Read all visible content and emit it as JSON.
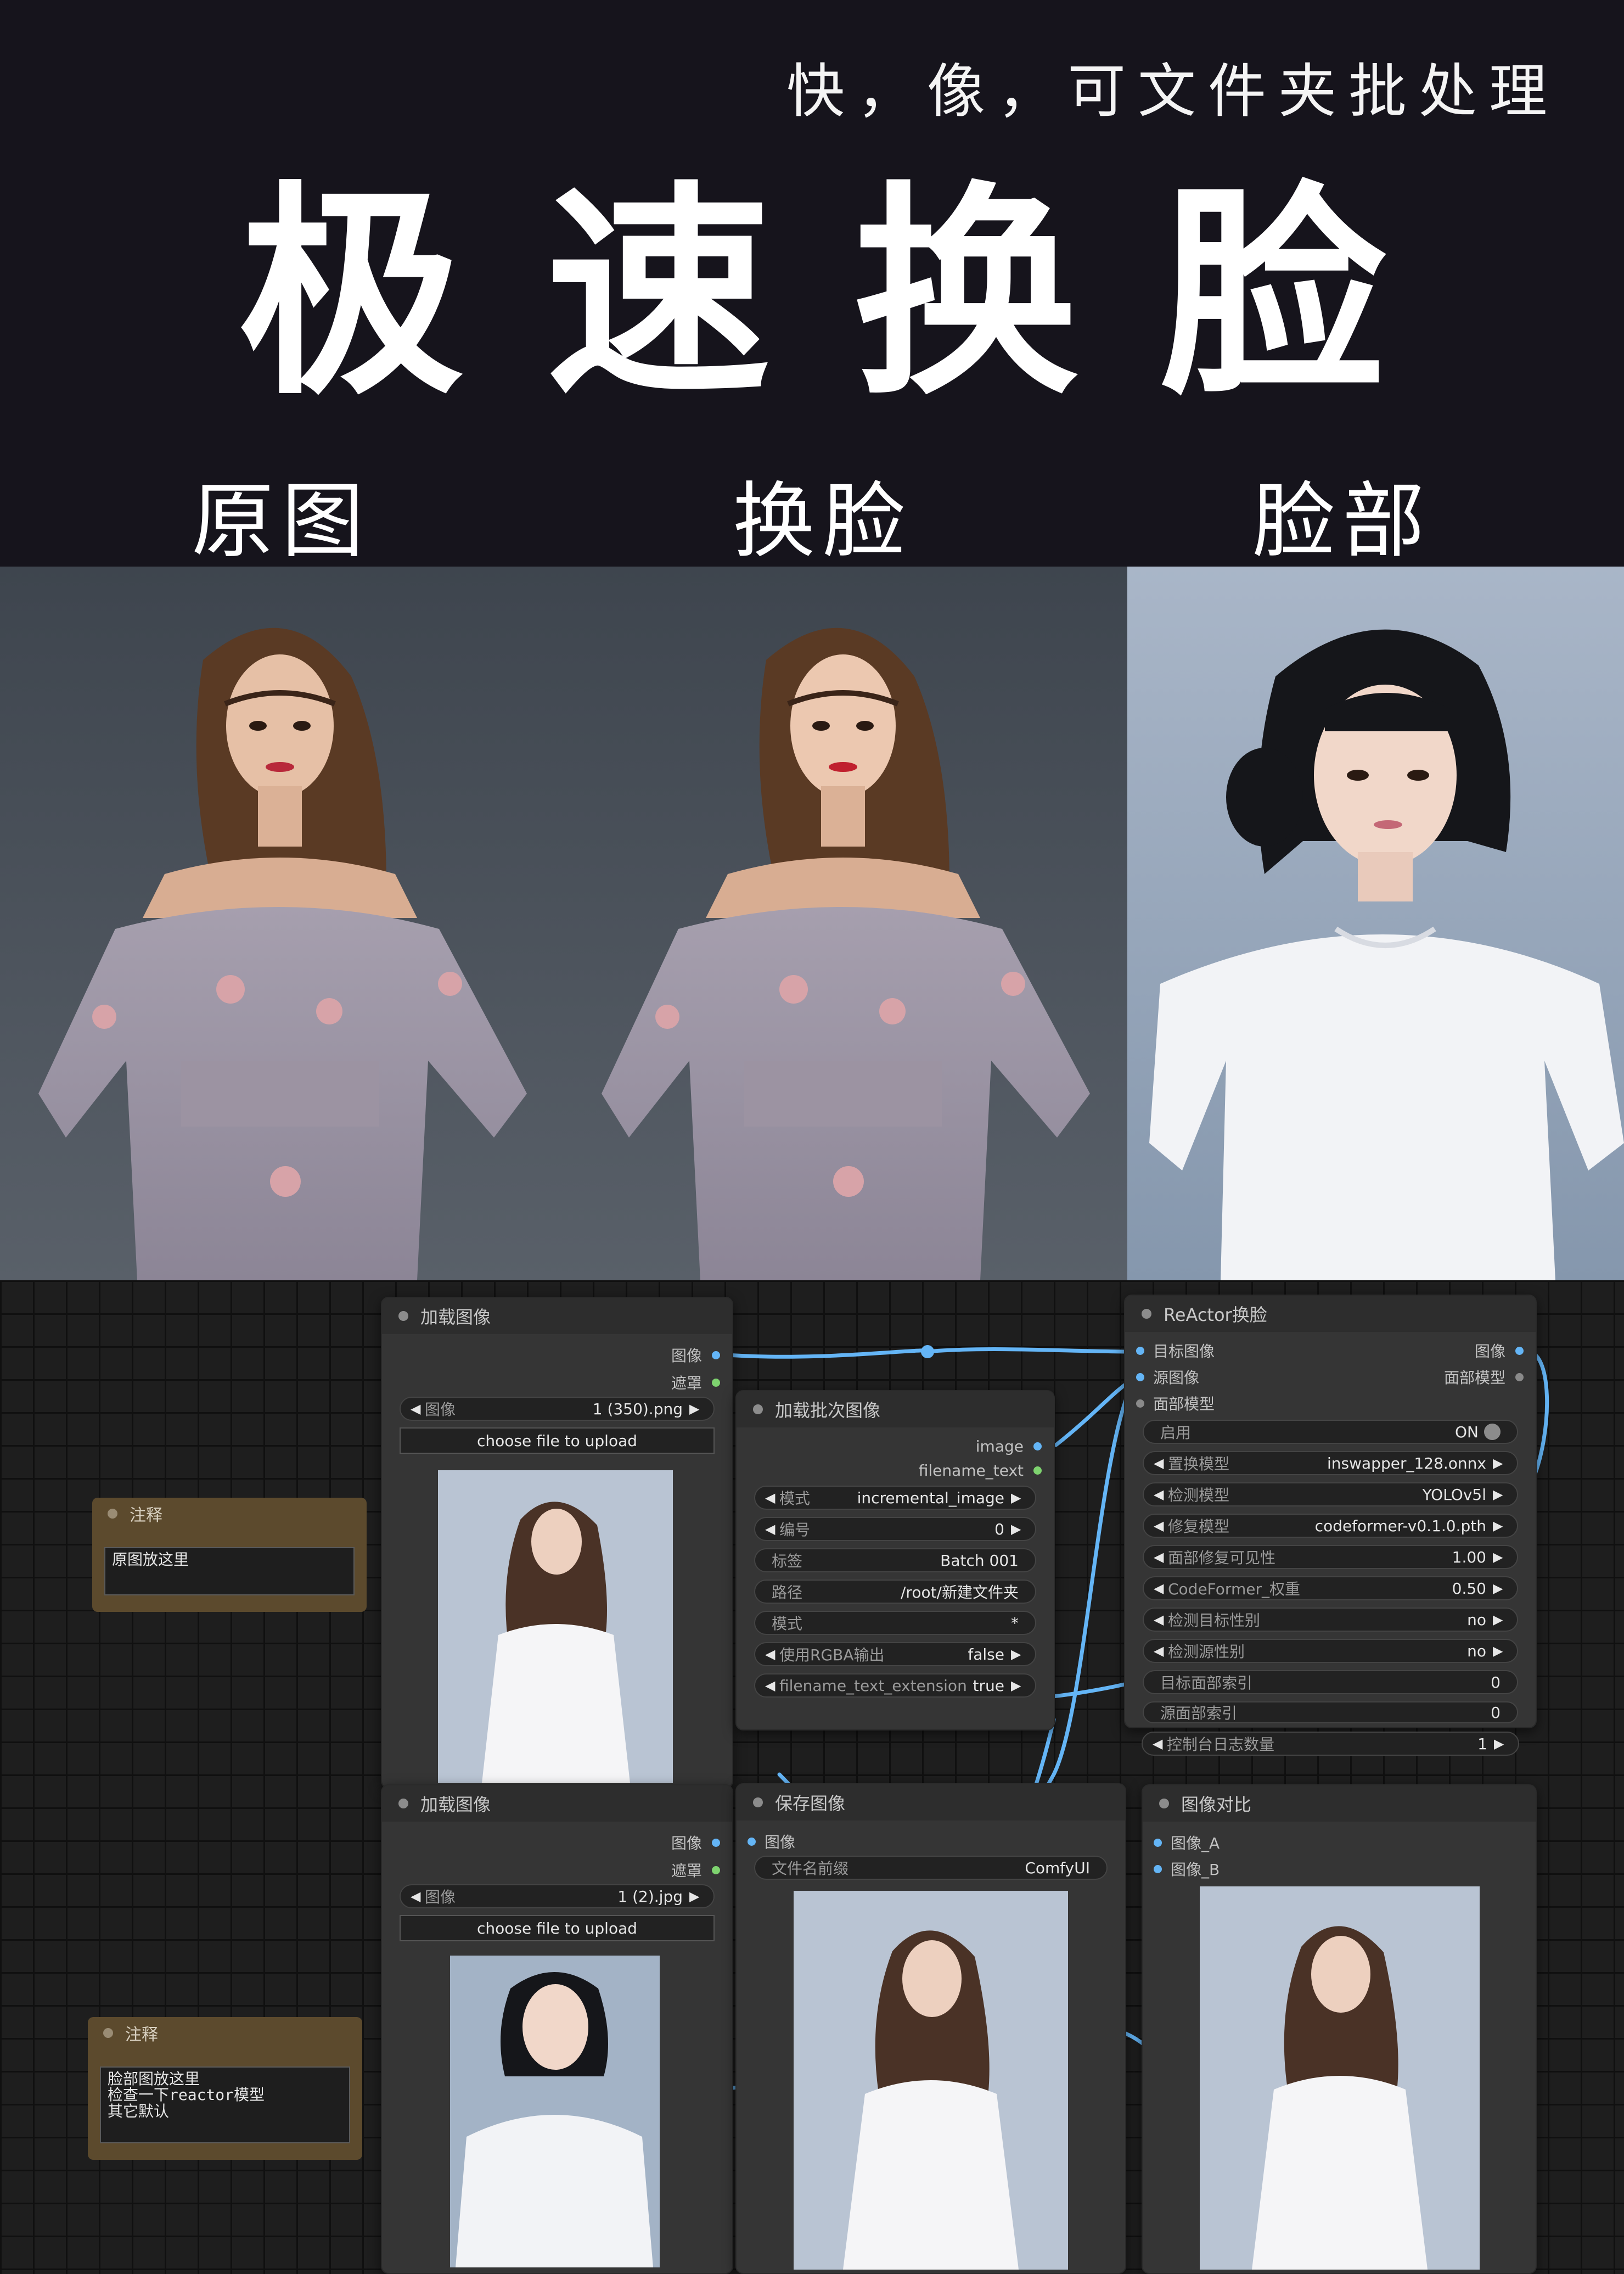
{
  "header": {
    "tagline": "快，像，可文件夹批处理",
    "title": "极速换脸",
    "columns": [
      "原图",
      "换脸",
      "脸部"
    ]
  },
  "colors": {
    "background": "#16141c",
    "canvas": "#1e1e1e",
    "node": "#353535",
    "note": "#5c4a2d",
    "link_image": "#64b5f6",
    "link_mask": "#7ed36f"
  },
  "nodes": {
    "load_image_1": {
      "title": "加载图像",
      "outputs": [
        "图像",
        "遮罩"
      ],
      "image_label": "图像",
      "image_value": "1 (350).png",
      "upload_button": "choose file to upload"
    },
    "load_batch": {
      "title": "加载批次图像",
      "outputs": [
        "image",
        "filename_text"
      ],
      "widgets": [
        {
          "label": "模式",
          "value": "incremental_image",
          "arrows": true
        },
        {
          "label": "编号",
          "value": "0",
          "arrows": true
        },
        {
          "label": "标签",
          "value": "Batch 001",
          "arrows": false
        },
        {
          "label": "路径",
          "value": "/root/新建文件夹",
          "arrows": false
        },
        {
          "label": "模式",
          "value": "*",
          "arrows": false
        },
        {
          "label": "使用RGBA输出",
          "value": "false",
          "arrows": true
        },
        {
          "label": "filename_text_extension",
          "value": "true",
          "arrows": true
        }
      ]
    },
    "reactor": {
      "title": "ReActor换脸",
      "inputs": [
        "目标图像",
        "源图像",
        "面部模型"
      ],
      "outputs": [
        "图像",
        "面部模型"
      ],
      "widgets": [
        {
          "label": "启用",
          "value": "ON",
          "arrows": false,
          "toggle": true
        },
        {
          "label": "置换模型",
          "value": "inswapper_128.onnx",
          "arrows": true
        },
        {
          "label": "检测模型",
          "value": "YOLOv5l",
          "arrows": true
        },
        {
          "label": "修复模型",
          "value": "codeformer-v0.1.0.pth",
          "arrows": true
        },
        {
          "label": "面部修复可见性",
          "value": "1.00",
          "arrows": true
        },
        {
          "label": "CodeFormer_权重",
          "value": "0.50",
          "arrows": true
        },
        {
          "label": "检测目标性别",
          "value": "no",
          "arrows": true
        },
        {
          "label": "检测源性别",
          "value": "no",
          "arrows": true
        },
        {
          "label": "目标面部索引",
          "value": "0",
          "arrows": false
        },
        {
          "label": "源面部索引",
          "value": "0",
          "arrows": false
        },
        {
          "label": "控制台日志数量",
          "value": "1",
          "arrows": true
        }
      ]
    },
    "load_image_2": {
      "title": "加载图像",
      "outputs": [
        "图像",
        "遮罩"
      ],
      "image_label": "图像",
      "image_value": "1 (2).jpg",
      "upload_button": "choose file to upload"
    },
    "save_image": {
      "title": "保存图像",
      "inputs": [
        "图像"
      ],
      "prefix_label": "文件名前缀",
      "prefix_value": "ComfyUI"
    },
    "compare": {
      "title": "图像对比",
      "inputs": [
        "图像_A",
        "图像_B"
      ]
    }
  },
  "notes": [
    {
      "title": "注释",
      "lines": [
        "原图放这里"
      ]
    },
    {
      "title": "注释",
      "lines": [
        "脸部图放这里",
        "检查一下reactor模型",
        "其它默认"
      ]
    }
  ]
}
